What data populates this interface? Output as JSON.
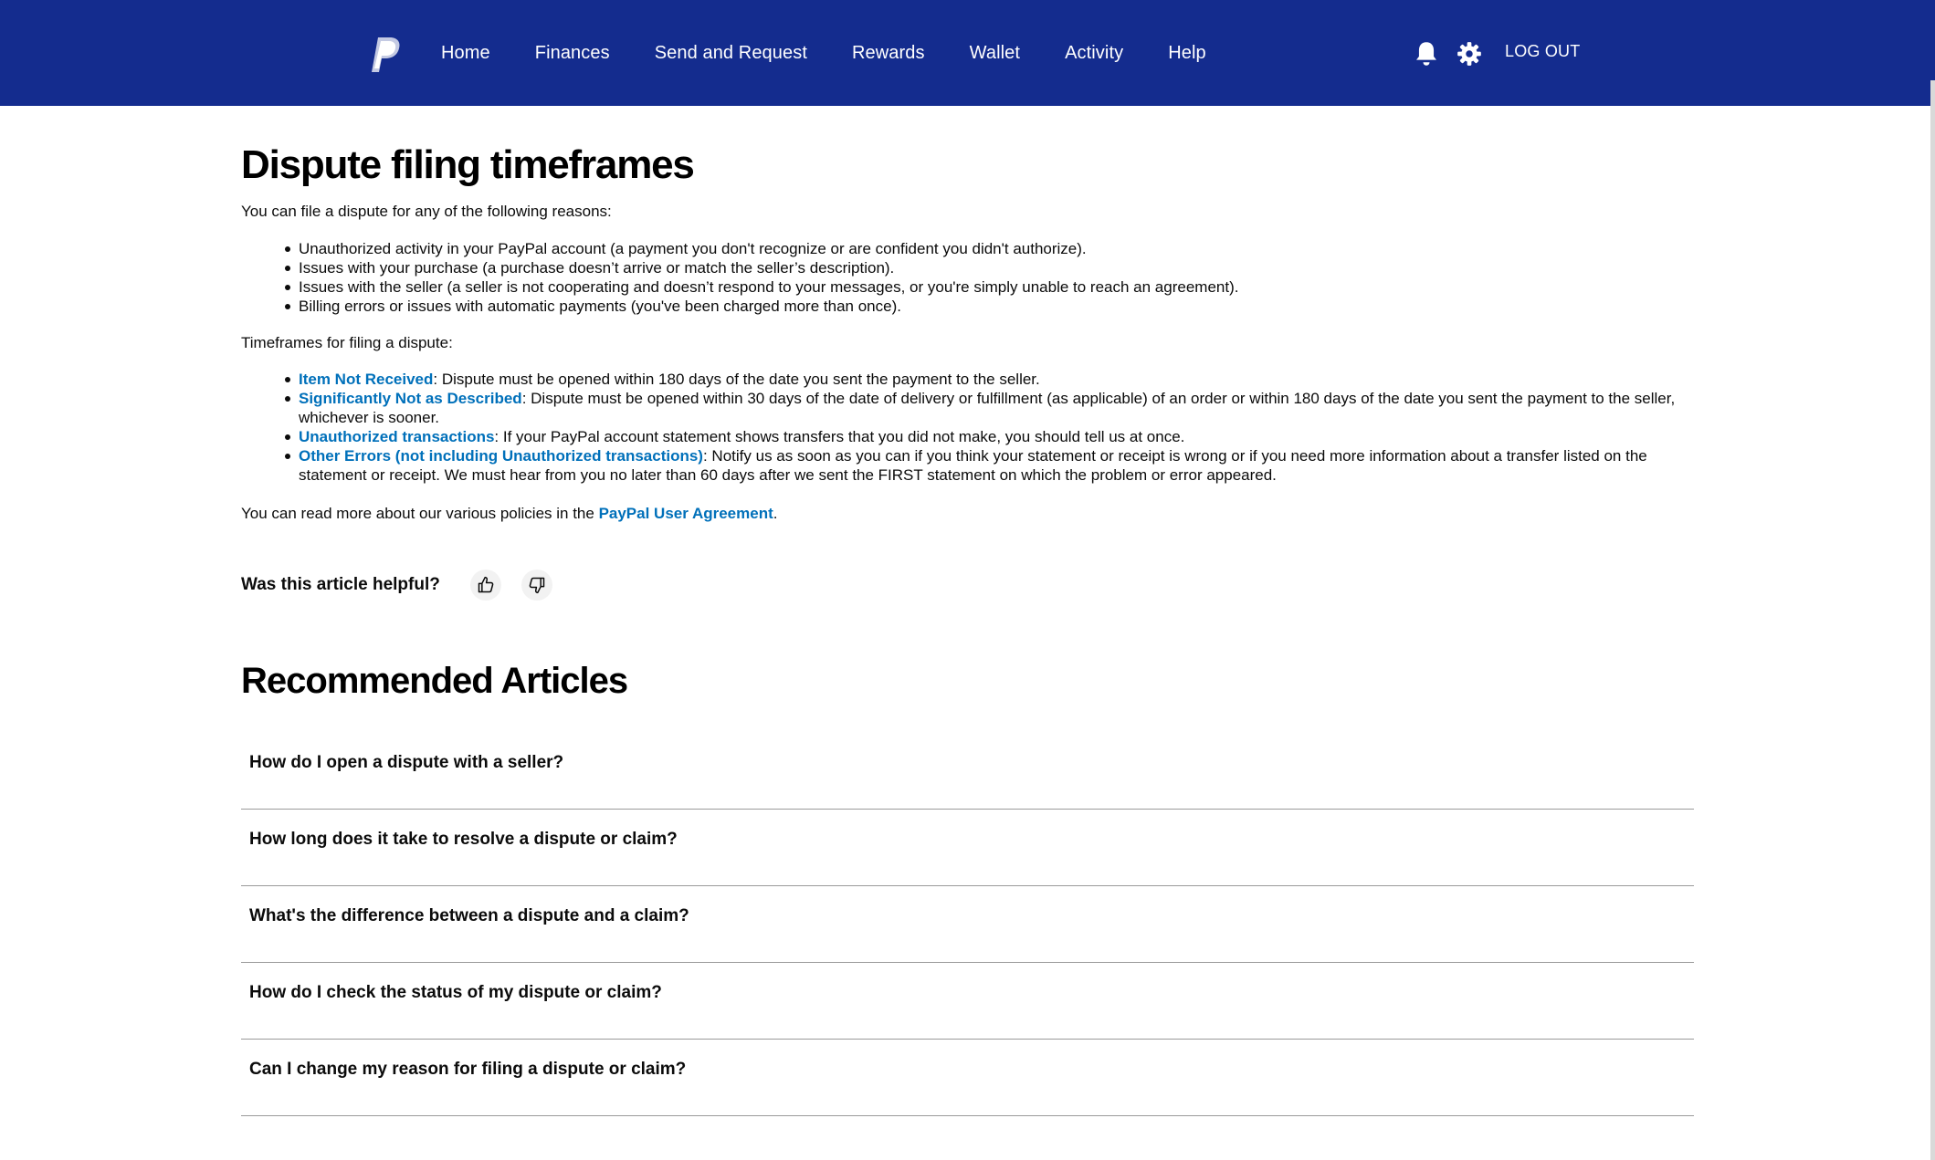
{
  "header": {
    "nav": [
      "Home",
      "Finances",
      "Send and Request",
      "Rewards",
      "Wallet",
      "Activity",
      "Help"
    ],
    "logout_label": "LOG OUT",
    "icons": {
      "logo": "paypal-logo",
      "notifications": "bell-icon",
      "settings": "gear-icon"
    },
    "background": "#142c8e"
  },
  "article": {
    "title": "Dispute filing timeframes",
    "intro": "You can file a dispute for any of the following reasons:",
    "reasons": [
      "Unauthorized activity in your PayPal account (a payment you don't recognize or are confident you didn't authorize).",
      "Issues with your purchase (a purchase doesn’t arrive or match the seller’s description).",
      "Issues with the seller (a seller is not cooperating and doesn’t respond to your messages, or you're simply unable to reach an agreement).",
      "Billing errors or issues with automatic payments (you've been charged more than once)."
    ],
    "timeframes_label": "Timeframes for filing a dispute:",
    "timeframes": [
      {
        "link": "Item Not Received",
        "text": ": Dispute must be opened within 180 days of the date you sent the payment to the seller."
      },
      {
        "link": "Significantly Not as Described",
        "text": ": Dispute must be opened within 30 days of the date of delivery or fulfillment (as applicable) of an order or within 180 days of the date you sent the payment to the seller, whichever is sooner."
      },
      {
        "link": "Unauthorized transactions",
        "text": ": If your PayPal account statement shows transfers that you did not make, you should tell us at once."
      },
      {
        "link": "Other Errors (not including Unauthorized transactions)",
        "text": ": Notify us as soon as you can if you think your statement or receipt is wrong or if you need more information about a transfer listed on the statement or receipt. We must hear from you no later than 60 days after we sent the FIRST statement on which the problem or error appeared."
      }
    ],
    "more_prefix": "You can read more about our various policies in the ",
    "more_link": "PayPal User Agreement",
    "more_suffix": ".",
    "link_color": "#0070ba"
  },
  "feedback": {
    "label": "Was this article helpful?",
    "icons": {
      "up": "thumbs-up-icon",
      "down": "thumbs-down-icon"
    }
  },
  "recommended": {
    "title": "Recommended Articles",
    "items": [
      "How do I open a dispute with a seller?",
      "How long does it take to resolve a dispute or claim?",
      "What's the difference between a dispute and a claim?",
      "How do I check the status of my dispute or claim?",
      "Can I change my reason for filing a dispute or claim?"
    ]
  }
}
